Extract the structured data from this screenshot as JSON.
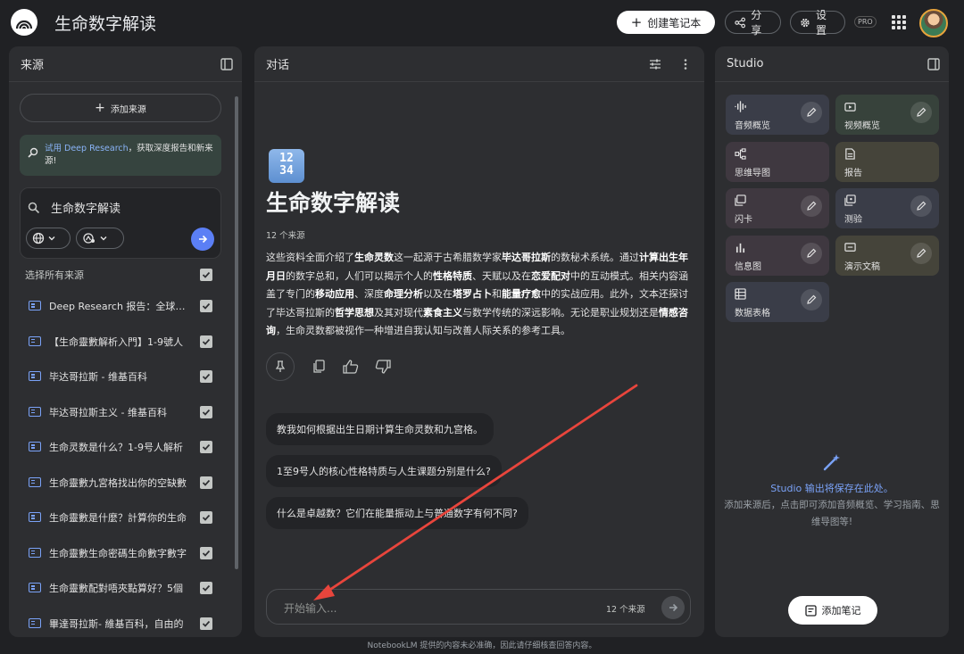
{
  "app": {
    "title": "生命数字解读",
    "create_label": "创建笔记本",
    "share_label": "分享",
    "settings_label": "设置",
    "pro_label": "PRO"
  },
  "sources_panel": {
    "title": "来源",
    "add_source_label": "添加来源",
    "deep_research_link": "试用 Deep Research",
    "deep_research_text": "，获取深度报告和新来源!",
    "search_value": "生命数字解读",
    "select_all_label": "选择所有来源",
    "items": [
      {
        "label": "Deep Research 报告：全球生命数字"
      },
      {
        "label": "【生命靈數解析入門】1-9號人"
      },
      {
        "label": "毕达哥拉斯 - 维基百科"
      },
      {
        "label": "毕达哥拉斯主义 - 维基百科"
      },
      {
        "label": "生命灵数是什么？1-9号人解析"
      },
      {
        "label": "生命靈數九宮格找出你的空缺數"
      },
      {
        "label": "生命靈數是什麼？計算你的生命"
      },
      {
        "label": "生命靈數生命密碼生命數字數字"
      },
      {
        "label": "生命靈數配對唔夾點算好？5個"
      },
      {
        "label": "畢達哥拉斯- 維基百科，自由的"
      }
    ]
  },
  "chat_panel": {
    "title": "对话",
    "emoji_text": "1234",
    "notebook_title": "生命数字解读",
    "source_count": "12 个来源",
    "summary": [
      {
        "t": "这些资料全面介绍了"
      },
      {
        "t": "生命灵数",
        "b": true
      },
      {
        "t": "这一起源于古希腊数学家"
      },
      {
        "t": "毕达哥拉斯",
        "b": true
      },
      {
        "t": "的数秘术系统。通过"
      },
      {
        "t": "计算出生年月日",
        "b": true
      },
      {
        "t": "的数字总和，人们可以揭示个人的"
      },
      {
        "t": "性格特质",
        "b": true
      },
      {
        "t": "、天赋以及在"
      },
      {
        "t": "恋爱配对",
        "b": true
      },
      {
        "t": "中的互动模式。相关内容涵盖了专门的"
      },
      {
        "t": "移动应用",
        "b": true
      },
      {
        "t": "、深度"
      },
      {
        "t": "命理分析",
        "b": true
      },
      {
        "t": "以及在"
      },
      {
        "t": "塔罗占卜",
        "b": true
      },
      {
        "t": "和"
      },
      {
        "t": "能量疗愈",
        "b": true
      },
      {
        "t": "中的实战应用。此外，文本还探讨了毕达哥拉斯的"
      },
      {
        "t": "哲学思想",
        "b": true
      },
      {
        "t": "及其对现代"
      },
      {
        "t": "素食主义",
        "b": true
      },
      {
        "t": "与数学传统的深远影响。无论是职业规划还是"
      },
      {
        "t": "情感咨询",
        "b": true
      },
      {
        "t": "，生命灵数都被视作一种增进自我认知与改善人际关系的参考工具。"
      }
    ],
    "suggestions": [
      "教我如何根据出生日期计算生命灵数和九宫格。",
      "1至9号人的核心性格特质与人生课题分别是什么?",
      "什么是卓越数？它们在能量振动上与普通数字有何不同?"
    ],
    "input_placeholder": "开始输入...",
    "input_source_count": "12 个来源"
  },
  "studio_panel": {
    "title": "Studio",
    "cards": [
      {
        "label": "音频概览",
        "icon": "audio-wave-icon",
        "color": "#3a3d48",
        "editable": true
      },
      {
        "label": "视频概览",
        "icon": "video-icon",
        "color": "#37423b",
        "editable": true
      },
      {
        "label": "思维导图",
        "icon": "mind-map-icon",
        "color": "#3f3840",
        "editable": false
      },
      {
        "label": "报告",
        "icon": "report-icon",
        "color": "#45443a",
        "editable": false
      },
      {
        "label": "闪卡",
        "icon": "flashcard-icon",
        "color": "#3f3840",
        "editable": true
      },
      {
        "label": "测验",
        "icon": "quiz-icon",
        "color": "#3a3d48",
        "editable": true
      },
      {
        "label": "信息图",
        "icon": "infographic-icon",
        "color": "#3f3840",
        "editable": true
      },
      {
        "label": "演示文稿",
        "icon": "slides-icon",
        "color": "#45443a",
        "editable": true
      },
      {
        "label": "数据表格",
        "icon": "table-icon",
        "color": "#3a3d48",
        "editable": true
      }
    ],
    "empty_title": "Studio 输出将保存在此处。",
    "empty_desc": "添加来源后，点击即可添加音频概览、学习指南、思维导图等!",
    "add_note_label": "添加笔记"
  },
  "footer": {
    "disclaimer": "NotebookLM 提供的内容未必准确，因此请仔细核查回答内容。"
  },
  "colors": {
    "background": "#202124",
    "panel": "#2d2e31",
    "accent_blue": "#5b7ff5",
    "annotation_arrow": "#e8453c"
  }
}
